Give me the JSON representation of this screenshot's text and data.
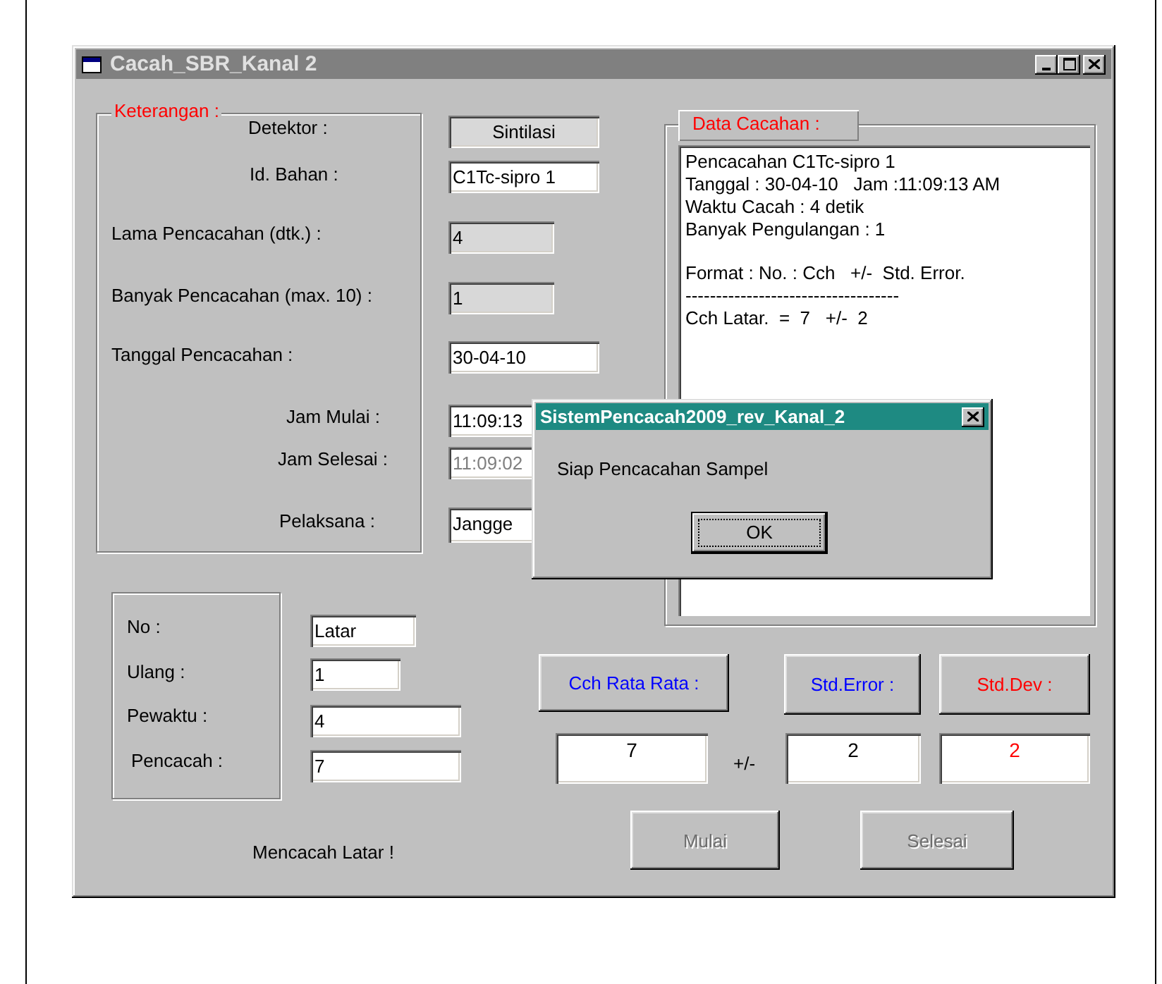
{
  "window": {
    "title": "Cacah_SBR_Kanal 2"
  },
  "info_group": {
    "label": "Keterangan :",
    "rows": [
      {
        "label": "Detektor :",
        "field": {
          "kind": "display",
          "value": "Sintilasi",
          "disabled": false
        }
      },
      {
        "label": "Id. Bahan :",
        "field": {
          "kind": "edit",
          "value": "C1Tc-sipro 1",
          "disabled": false
        }
      },
      {
        "label": "Lama Pencacahan (dtk.) :",
        "field": {
          "kind": "readonly",
          "value": "4",
          "disabled": false
        }
      },
      {
        "label": "Banyak Pencacahan (max. 10) :",
        "field": {
          "kind": "readonly",
          "value": "1",
          "disabled": false
        }
      },
      {
        "label": "Tanggal Pencacahan :",
        "field": {
          "kind": "edit",
          "value": "30-04-10",
          "disabled": false
        }
      },
      {
        "label": "Jam Mulai :",
        "field": {
          "kind": "edit",
          "value": "11:09:13",
          "disabled": false
        }
      },
      {
        "label": "Jam Selesai :",
        "field": {
          "kind": "edit",
          "value": "11:09:02",
          "disabled": true
        }
      },
      {
        "label": "Pelaksana :",
        "field": {
          "kind": "edit",
          "value": "Jangge",
          "disabled": false
        }
      }
    ]
  },
  "data_group": {
    "label": "Data Cacahan :",
    "blocks": [
      [
        "Pencacahan C1Tc-sipro 1",
        "Tanggal : 30-04-10   Jam :11:09:13 AM",
        "Waktu Cacah : 4 detik",
        "Banyak Pengulangan : 1"
      ],
      [
        "Format : No. : Cch   +/-  Std. Error.",
        "-----------------------------------",
        "Cch Latar.  =  7   +/-  2"
      ]
    ]
  },
  "count_group": {
    "rows": [
      {
        "label": "No :",
        "value": "Latar"
      },
      {
        "label": "Ulang :",
        "value": "1"
      },
      {
        "label": "Pewaktu :",
        "value": "4"
      },
      {
        "label": "Pencacah :",
        "value": "7"
      }
    ]
  },
  "result_headers": [
    {
      "label": "Cch Rata Rata :",
      "color": "#0000ff"
    },
    {
      "label": "Std.Error :",
      "color": "#0000ff"
    },
    {
      "label": "Std.Dev :",
      "color": "#ff0000"
    }
  ],
  "results": {
    "mean": {
      "value": "7",
      "color": "#000000"
    },
    "separator": "+/-",
    "std_error": {
      "value": "2",
      "color": "#000000"
    },
    "std_dev": {
      "value": "2",
      "color": "#ff0000"
    }
  },
  "buttons": [
    {
      "label": "Mulai",
      "disabled": true
    },
    {
      "label": "Selesai",
      "disabled": true
    }
  ],
  "status": "Mencacah Latar !",
  "dialog": {
    "title": "SistemPencacah2009_rev_Kanal_2",
    "message": "Siap Pencacahan Sampel",
    "button": "OK"
  }
}
